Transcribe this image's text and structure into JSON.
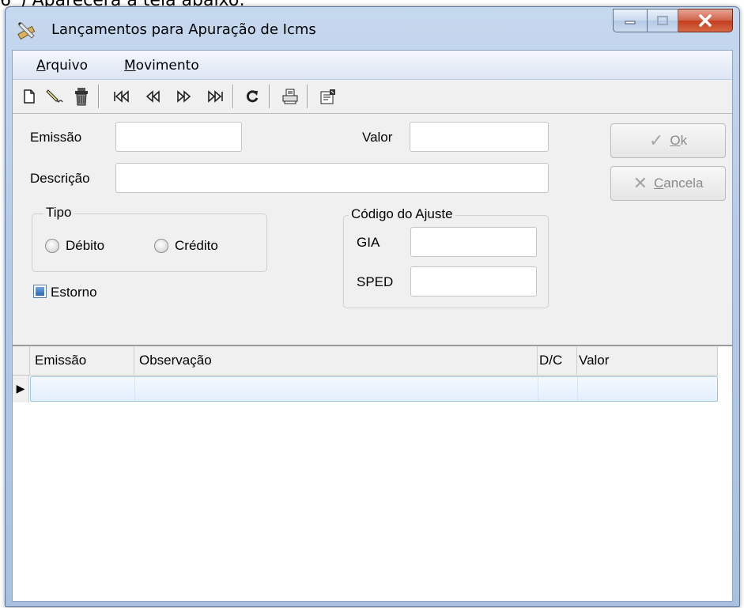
{
  "page_caption": "6°) Aparecerá a tela abaixo:",
  "window": {
    "title": "Lançamentos para Apuração de Icms",
    "icon": "pencil-ruler-icon"
  },
  "menu": {
    "arquivo_first": "A",
    "arquivo_rest": "rquivo",
    "movimento_first": "M",
    "movimento_rest": "ovimento"
  },
  "toolbar": {
    "icons": [
      "new-document-icon",
      "edit-icon",
      "delete-trash-icon",
      "first-record-icon",
      "previous-record-icon",
      "next-record-icon",
      "last-record-icon",
      "refresh-icon",
      "print-icon",
      "properties-icon"
    ]
  },
  "form": {
    "emissao_label": "Emissão",
    "emissao_value": "",
    "valor_label": "Valor",
    "valor_value": "",
    "descricao_label": "Descrição",
    "descricao_value": "",
    "tipo_group": "Tipo",
    "debito_label": "Débito",
    "credito_label": "Crédito",
    "estorno_label": "Estorno",
    "codigo_group": "Código do Ajuste",
    "gia_label": "GIA",
    "gia_value": "",
    "sped_label": "SPED",
    "sped_value": ""
  },
  "buttons": {
    "ok_first": "O",
    "ok_rest": "k",
    "cancela_first": "C",
    "cancela_rest": "ancela"
  },
  "grid": {
    "columns": [
      "Emissão",
      "Observação",
      "D/C",
      "Valor"
    ],
    "rows": [
      {
        "emissao": "",
        "observacao": "",
        "dc": "",
        "valor": ""
      }
    ]
  }
}
